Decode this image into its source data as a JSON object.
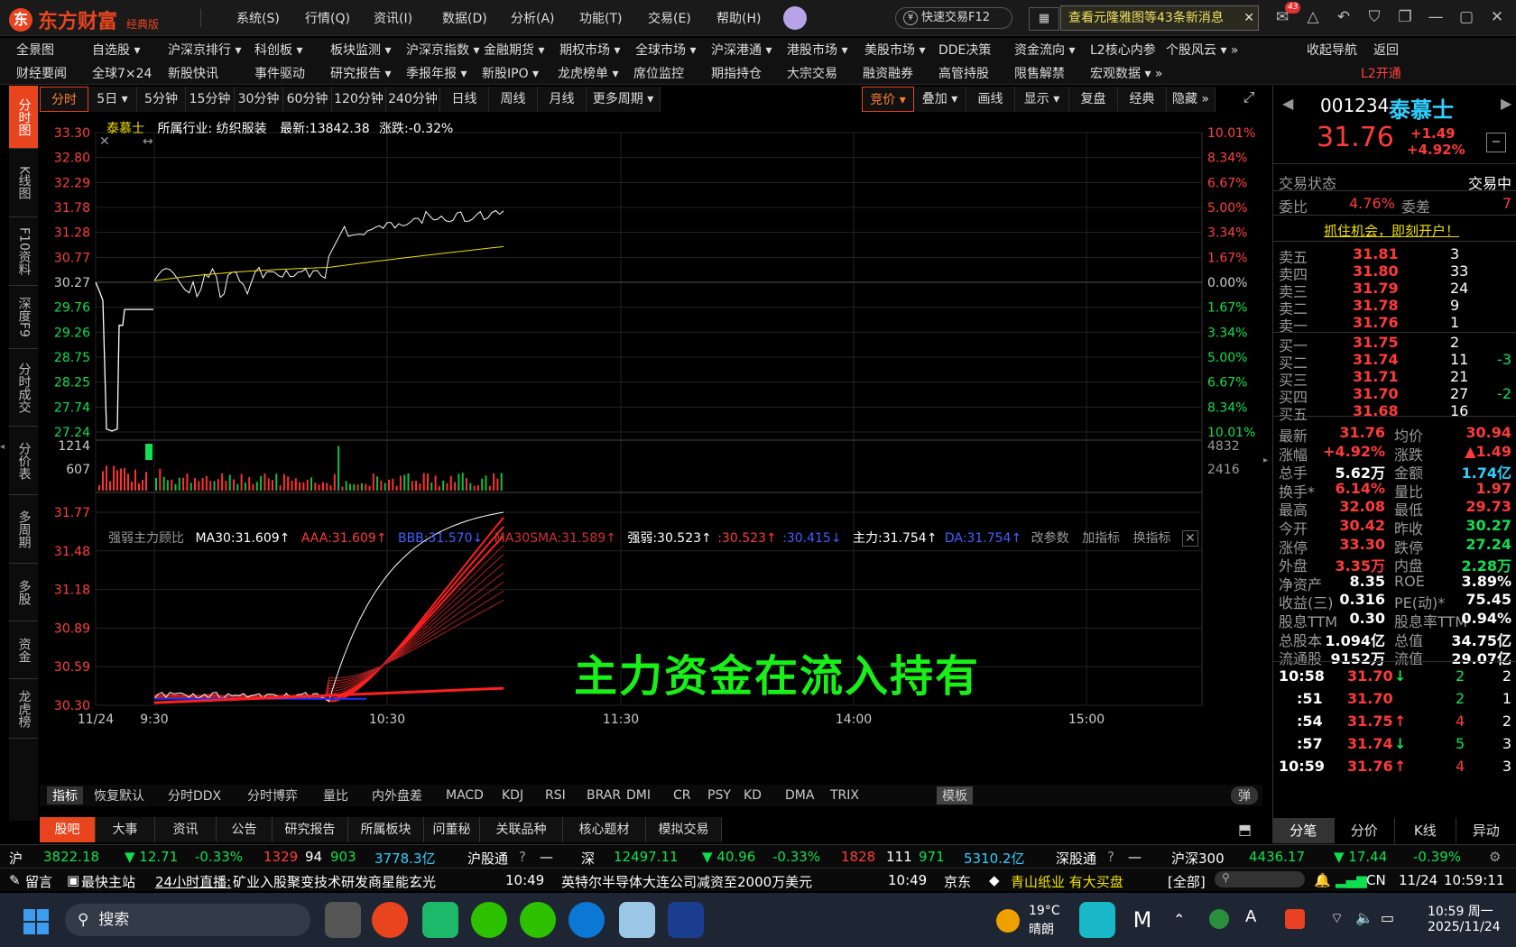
{
  "app": {
    "logo": "东方财富",
    "edition": "经典版",
    "menu": [
      "系统(S)",
      "行情(Q)",
      "资讯(I)",
      "数据(D)",
      "分析(A)",
      "功能(T)",
      "交易(E)",
      "帮助(H)"
    ],
    "quick_trade": "快速交易F12",
    "message": "查看元隆雅图等43条新消息",
    "badge": "43"
  },
  "nav1": [
    "全景图",
    "自选股 ▾",
    "沪深京排行 ▾",
    "科创板 ▾",
    "板块监测 ▾",
    "沪深京指数 ▾",
    "金融期货 ▾",
    "期权市场 ▾",
    "全球市场 ▾",
    "沪深港通 ▾",
    "港股市场 ▾",
    "美股市场 ▾",
    "DDE决策",
    "资金流向 ▾",
    "L2核心内参",
    "个股风云 ▾ »",
    "收起导航",
    "返回"
  ],
  "nav2": [
    "财经要闻",
    "全球7×24",
    "新股快讯",
    "事件驱动",
    "研究报告 ▾",
    "季报年报 ▾",
    "新股IPO ▾",
    "龙虎榜单 ▾",
    "席位监控",
    "期指持仓",
    "大宗交易",
    "融资融券",
    "高管持股",
    "限售解禁",
    "宏观数据 ▾ »",
    "L2开通"
  ],
  "leftbar": [
    "分时图",
    "K线图",
    "F10资料",
    "深度F9",
    "分时成交",
    "分价表",
    "多周期",
    "多股",
    "资金",
    "龙虎榜"
  ],
  "periods": [
    "分时",
    "5日 ▾",
    "5分钟",
    "15分钟",
    "30分钟",
    "60分钟",
    "120分钟",
    "240分钟",
    "日线",
    "周线",
    "月线",
    "更多周期 ▾"
  ],
  "rightctrl": [
    "竞价 ▾",
    "叠加 ▾",
    "画线",
    "显示 ▾",
    "复盘",
    "经典",
    "隐藏 »"
  ],
  "chart_info": {
    "name": "泰慕士",
    "industry": "所属行业: 纺织服装",
    "latest": "最新:13842.38",
    "change": "涨跌:-0.32%"
  },
  "indicator_legend": {
    "name": "强弱主力顾比",
    "ma30": "MA30:31.609↑",
    "aaa": "AAA:31.609↑",
    "bbb": "BBB:31.570↓",
    "ma30sma": "MA30SMA:31.589↑",
    "qr": "强弱:30.523↑",
    "qr2": ":30.523↑",
    "qr3": ":30.415↓",
    "zl": "主力:31.754↑",
    "da": "DA:31.754↑",
    "btn1": "改参数",
    "btn2": "加指标",
    "btn3": "换指标"
  },
  "overlay_text": "主力资金在流入持有",
  "chart_data": {
    "type": "line",
    "price_ticks": [
      "33.30",
      "32.80",
      "32.29",
      "31.78",
      "31.28",
      "30.77",
      "30.27",
      "29.76",
      "29.26",
      "28.75",
      "28.25",
      "27.74",
      "27.24"
    ],
    "pct_ticks": [
      "10.01%",
      "8.34%",
      "6.67%",
      "5.00%",
      "3.34%",
      "1.67%",
      "0.00%",
      "1.67%",
      "3.34%",
      "5.00%",
      "6.67%",
      "8.34%",
      "10.01%"
    ],
    "vol_ticks": [
      "1214",
      "607"
    ],
    "vol_right": [
      "4832",
      "2416"
    ],
    "ind_ticks": [
      "31.77",
      "31.48",
      "31.18",
      "30.89",
      "30.59",
      "30.30"
    ],
    "time_ticks": [
      "11/24",
      "9:30",
      "10:30",
      "11:30",
      "14:00",
      "15:00"
    ],
    "prev_close": 30.27,
    "ylim": [
      27.24,
      33.3
    ]
  },
  "indbar": [
    "指标",
    "恢复默认",
    "分时DDX",
    "分时博弈",
    "量比",
    "内外盘差",
    "MACD",
    "KDJ",
    "RSI",
    "BRAR",
    "DMI",
    "CR",
    "PSY",
    "KD",
    "DMA",
    "TRIX",
    "模板",
    "弹"
  ],
  "bottomtabs": [
    "股吧",
    "大事",
    "资讯",
    "公告",
    "研究报告",
    "所属板块",
    "问董秘",
    "关联品种",
    "核心题材",
    "模拟交易"
  ],
  "status": {
    "sh": "沪",
    "sh_val": "3822.18",
    "sh_chg": "▼ 12.71",
    "sh_pct": "-0.33%",
    "sh_up": "1329",
    "sh_flat": "94",
    "sh_down": "903",
    "sh_amt": "3778.3亿",
    "hgt": "沪股通",
    "dash1": "—",
    "sz": "深",
    "sz_val": "12497.11",
    "sz_chg": "▼ 40.96",
    "sz_pct": "-0.33%",
    "sz_up": "1828",
    "sz_flat": "111",
    "sz_down": "971",
    "sz_amt": "5310.2亿",
    "sgt": "深股通",
    "dash2": "—",
    "hs300": "沪深300",
    "hs_val": "4436.17",
    "hs_chg": "▼ 17.44",
    "hs_pct": "-0.39%"
  },
  "news": {
    "msg": "留言",
    "host": "最快主站",
    "live": "24小时直播:",
    "n1": "矿业入股聚变技术研发商星能玄光",
    "t1": "10:49",
    "n2": "英特尔半导体大连公司减资至2000万美元",
    "t2": "10:49",
    "n3": "京东",
    "stock": "青山纸业 有大买盘",
    "all": "[全部]",
    "cn": "CN",
    "date": "11/24",
    "time": "10:59:11"
  },
  "quote": {
    "code": "001234",
    "name": "泰慕士",
    "price": "31.76",
    "chg": "+1.49",
    "pct": "+4.92%",
    "state_label": "交易状态",
    "state": "交易中",
    "wb_label": "委比",
    "wb": "4.76%",
    "wc_label": "委差",
    "wc": "7",
    "promo": "抓住机会，即刻开户！",
    "asks": [
      [
        "卖五",
        "31.81",
        "3"
      ],
      [
        "卖四",
        "31.80",
        "33"
      ],
      [
        "卖三",
        "31.79",
        "24"
      ],
      [
        "卖二",
        "31.78",
        "9"
      ],
      [
        "卖一",
        "31.76",
        "1"
      ]
    ],
    "bids": [
      [
        "买一",
        "31.75",
        "2",
        ""
      ],
      [
        "买二",
        "31.74",
        "11",
        "-3"
      ],
      [
        "买三",
        "31.71",
        "21",
        ""
      ],
      [
        "买四",
        "31.70",
        "27",
        "-2"
      ],
      [
        "买五",
        "31.68",
        "16",
        ""
      ]
    ],
    "stats": [
      [
        "最新",
        "31.76",
        "均价",
        "30.94"
      ],
      [
        "涨幅",
        "+4.92%",
        "涨跌",
        "▲1.49"
      ],
      [
        "总手",
        "5.62万",
        "金额",
        "1.74亿"
      ],
      [
        "换手*",
        "6.14%",
        "量比",
        "1.97"
      ],
      [
        "最高",
        "32.08",
        "最低",
        "29.73"
      ],
      [
        "今开",
        "30.42",
        "昨收",
        "30.27"
      ],
      [
        "涨停",
        "33.30",
        "跌停",
        "27.24"
      ],
      [
        "外盘",
        "3.35万",
        "内盘",
        "2.28万"
      ],
      [
        "净资产",
        "8.35",
        "ROE",
        "3.89%"
      ],
      [
        "收益(三)",
        "0.316",
        "PE(动)*",
        "75.45"
      ],
      [
        "股息TTM",
        "0.30",
        "股息率TTM",
        "0.94%"
      ],
      [
        "总股本",
        "1.094亿",
        "总值",
        "34.75亿"
      ],
      [
        "流通股",
        "9152万",
        "流值",
        "29.07亿"
      ]
    ],
    "ticks": [
      [
        "10:58",
        "31.70",
        "↓",
        "2",
        "2"
      ],
      [
        ":51",
        "31.70",
        "",
        "2",
        "1"
      ],
      [
        ":54",
        "31.75",
        "↑",
        "4",
        "2"
      ],
      [
        ":57",
        "31.74",
        "↓",
        "5",
        "3"
      ],
      [
        "10:59",
        "31.76",
        "↑",
        "4",
        "3"
      ]
    ],
    "tabs": [
      "分笔",
      "分价",
      "K线",
      "异动"
    ]
  },
  "taskbar": {
    "search": "搜索",
    "weather": "19°C",
    "weather2": "晴朗",
    "time": "10:59 周一",
    "date": "2025/11/24"
  }
}
